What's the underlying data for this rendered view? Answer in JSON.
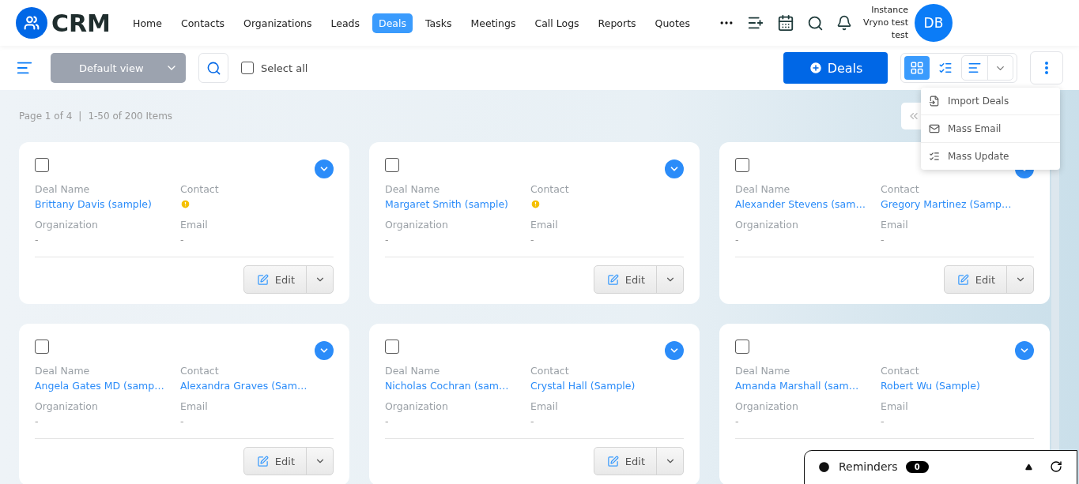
{
  "header": {
    "logo": "CRM",
    "nav": [
      {
        "label": "Home",
        "selected": false
      },
      {
        "label": "Contacts",
        "selected": false
      },
      {
        "label": "Organizations",
        "selected": false
      },
      {
        "label": "Leads",
        "selected": false
      },
      {
        "label": "Deals",
        "selected": true
      },
      {
        "label": "Tasks",
        "selected": false
      },
      {
        "label": "Meetings",
        "selected": false
      },
      {
        "label": "Call Logs",
        "selected": false
      },
      {
        "label": "Reports",
        "selected": false
      },
      {
        "label": "Quotes",
        "selected": false
      }
    ],
    "user": {
      "lines": [
        "Instance",
        "Vryno test",
        "test"
      ],
      "initials": "DB"
    }
  },
  "toolbar": {
    "view": "Default view",
    "select_all": {
      "label": "Select all",
      "checked": false
    },
    "add_button": "Deals",
    "layout_options": [
      {
        "kind": "grid",
        "selected": true
      },
      {
        "kind": "list",
        "selected": false
      }
    ]
  },
  "menu": [
    {
      "kind": "import",
      "label": "Import Deals"
    },
    {
      "kind": "email",
      "label": "Mass Email"
    },
    {
      "kind": "update",
      "label": "Mass Update"
    }
  ],
  "pagination": {
    "page": "Page 1 of 4",
    "separator": "|",
    "range": "1-50 of 200 Items"
  },
  "cards": [
    {
      "checked": false,
      "edit_label": "Edit",
      "fields": [
        {
          "label": "Deal Name",
          "kind": "link",
          "value": "Brittany Davis (sample)"
        },
        {
          "label": "Contact",
          "kind": "warning"
        },
        {
          "label": "Organization",
          "kind": "text",
          "value": "-"
        },
        {
          "label": "Email",
          "kind": "text",
          "value": "-"
        }
      ]
    },
    {
      "checked": false,
      "edit_label": "Edit",
      "fields": [
        {
          "label": "Deal Name",
          "kind": "link",
          "value": "Margaret Smith (sample)"
        },
        {
          "label": "Contact",
          "kind": "warning"
        },
        {
          "label": "Organization",
          "kind": "text",
          "value": "-"
        },
        {
          "label": "Email",
          "kind": "text",
          "value": "-"
        }
      ]
    },
    {
      "checked": false,
      "edit_label": "Edit",
      "fields": [
        {
          "label": "Deal Name",
          "kind": "link",
          "value": "Alexander Stevens (sam…"
        },
        {
          "label": "Contact",
          "kind": "link",
          "value": "Gregory Martinez (Samp…"
        },
        {
          "label": "Organization",
          "kind": "text",
          "value": "-"
        },
        {
          "label": "Email",
          "kind": "text",
          "value": "-"
        }
      ]
    },
    {
      "checked": false,
      "edit_label": "Edit",
      "fields": [
        {
          "label": "Deal Name",
          "kind": "link",
          "value": "Angela Gates MD (samp…"
        },
        {
          "label": "Contact",
          "kind": "link",
          "value": "Alexandra Graves (Sam…"
        },
        {
          "label": "Organization",
          "kind": "text",
          "value": "-"
        },
        {
          "label": "Email",
          "kind": "text",
          "value": "-"
        }
      ]
    },
    {
      "checked": false,
      "edit_label": "Edit",
      "fields": [
        {
          "label": "Deal Name",
          "kind": "link",
          "value": "Nicholas Cochran (sam…"
        },
        {
          "label": "Contact",
          "kind": "link",
          "value": "Crystal Hall (Sample)"
        },
        {
          "label": "Organization",
          "kind": "text",
          "value": "-"
        },
        {
          "label": "Email",
          "kind": "text",
          "value": "-"
        }
      ]
    },
    {
      "checked": false,
      "fields": [
        {
          "label": "Deal Name",
          "kind": "link",
          "value": "Amanda Marshall (sam…"
        },
        {
          "label": "Contact",
          "kind": "link",
          "value": "Robert Wu (Sample)"
        },
        {
          "label": "Organization",
          "kind": "text",
          "value": "-"
        },
        {
          "label": "Email",
          "kind": "text",
          "value": "-"
        }
      ]
    }
  ],
  "reminders": {
    "label": "Reminders",
    "count": "0"
  }
}
